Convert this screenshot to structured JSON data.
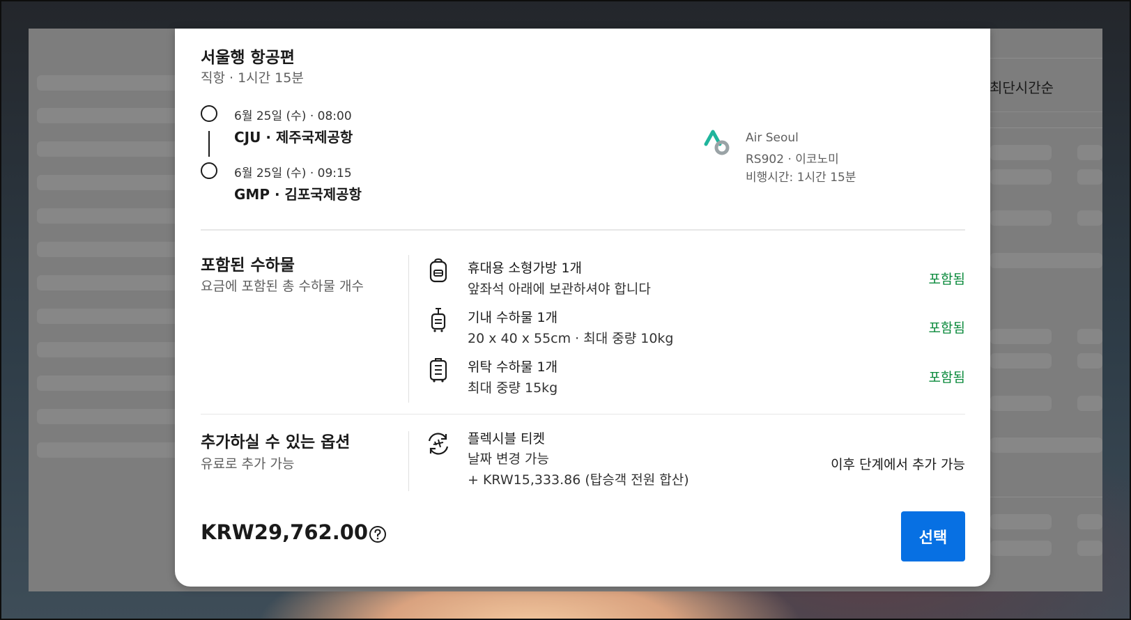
{
  "background_page": {
    "sort_label": "최단시간순"
  },
  "modal": {
    "title": "서울행 항공편",
    "subtitle": "직항 · 1시간 15분",
    "departure": {
      "datetime": "6월 25일 (수) · 08:00",
      "airport": "CJU · 제주국제공항"
    },
    "arrival": {
      "datetime": "6월 25일 (수) · 09:15",
      "airport": "GMP · 김포국제공항"
    },
    "airline": {
      "name": "Air Seoul",
      "flight": "RS902 · 이코노미",
      "duration": "비행시간: 1시간 15분",
      "logo_colors": [
        "#1fb59c",
        "#9aa3a6"
      ]
    },
    "baggage": {
      "title": "포함된 수하물",
      "subtitle": "요금에 포함된 총 수하물 개수",
      "items": [
        {
          "icon": "backpack-icon",
          "line1": "휴대용 소형가방 1개",
          "line2": "앞좌석 아래에 보관하셔야 합니다",
          "status": "포함됨"
        },
        {
          "icon": "cabin-bag-icon",
          "line1": "기내 수하물 1개",
          "line2": "20 x 40 x 55cm · 최대 중량 10kg",
          "status": "포함됨"
        },
        {
          "icon": "checked-bag-icon",
          "line1": "위탁 수하물 1개",
          "line2": "최대 중량 15kg",
          "status": "포함됨"
        }
      ]
    },
    "options": {
      "title": "추가하실 수 있는 옵션",
      "subtitle": "유료로 추가 가능",
      "item": {
        "icon": "flexible-ticket-icon",
        "line1": "플렉시블 티켓",
        "line2": "날짜 변경 가능",
        "line3": "+ KRW15,333.86 (탑승객 전원 합산)",
        "status": "이후 단계에서 추가 가능"
      }
    },
    "footer": {
      "price": "KRW29,762.00",
      "help_icon": "question-circle-icon",
      "select_label": "선택",
      "select_color": "#0770e3"
    },
    "colors": {
      "included_green": "#0b8a3c",
      "accent_blue": "#0770e3"
    }
  }
}
